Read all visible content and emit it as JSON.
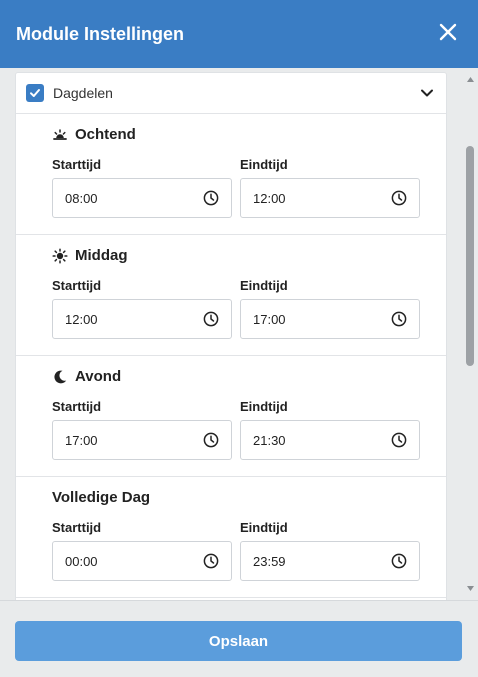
{
  "header": {
    "title": "Module Instellingen",
    "close_icon": "close-icon"
  },
  "panel": {
    "label": "Dagdelen",
    "checked": true
  },
  "sections": [
    {
      "title": "Ochtend",
      "icon": "sunrise-icon",
      "start_label": "Starttijd",
      "end_label": "Eindtijd",
      "start": "08:00",
      "end": "12:00"
    },
    {
      "title": "Middag",
      "icon": "sun-icon",
      "start_label": "Starttijd",
      "end_label": "Eindtijd",
      "start": "12:00",
      "end": "17:00"
    },
    {
      "title": "Avond",
      "icon": "moon-icon",
      "start_label": "Starttijd",
      "end_label": "Eindtijd",
      "start": "17:00",
      "end": "21:30"
    },
    {
      "title": "Volledige Dag",
      "icon": "",
      "start_label": "Starttijd",
      "end_label": "Eindtijd",
      "start": "00:00",
      "end": "23:59"
    }
  ],
  "footer": {
    "save_label": "Opslaan"
  },
  "colors": {
    "header": "#3a7dc4",
    "button": "#5b9ddc",
    "checkbox": "#3a7dc4"
  }
}
